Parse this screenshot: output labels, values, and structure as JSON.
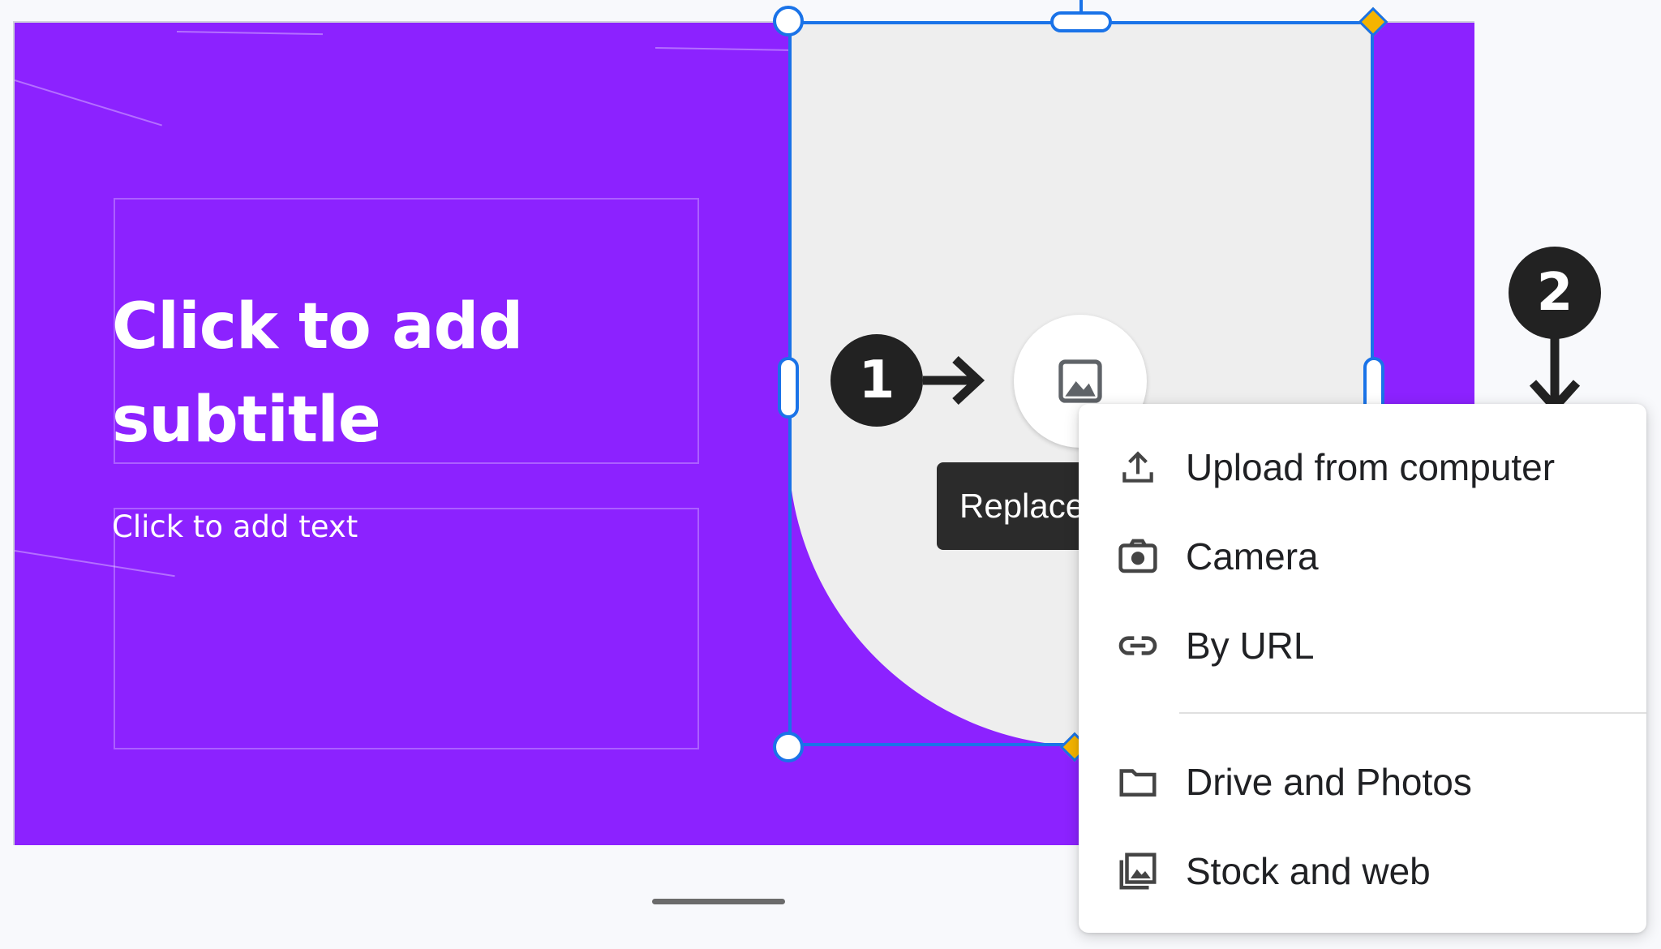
{
  "slide": {
    "subtitle_placeholder": "Click to add subtitle",
    "text_placeholder": "Click to add text",
    "background_color": "#8c22ff"
  },
  "image_placeholder": {
    "replace_icon": "image-icon",
    "tooltip_label": "Replace"
  },
  "annotations": {
    "step1": "1",
    "step2": "2"
  },
  "replace_menu": {
    "items": [
      {
        "icon": "upload-icon",
        "label": "Upload from computer"
      },
      {
        "icon": "camera-icon",
        "label": "Camera"
      },
      {
        "icon": "link-icon",
        "label": "By URL"
      },
      {
        "icon": "folder-icon",
        "label": "Drive and Photos"
      },
      {
        "icon": "photo-library-icon",
        "label": "Stock and web"
      }
    ]
  },
  "colors": {
    "selection": "#1a73e8",
    "accent_handle": "#f5b400"
  }
}
